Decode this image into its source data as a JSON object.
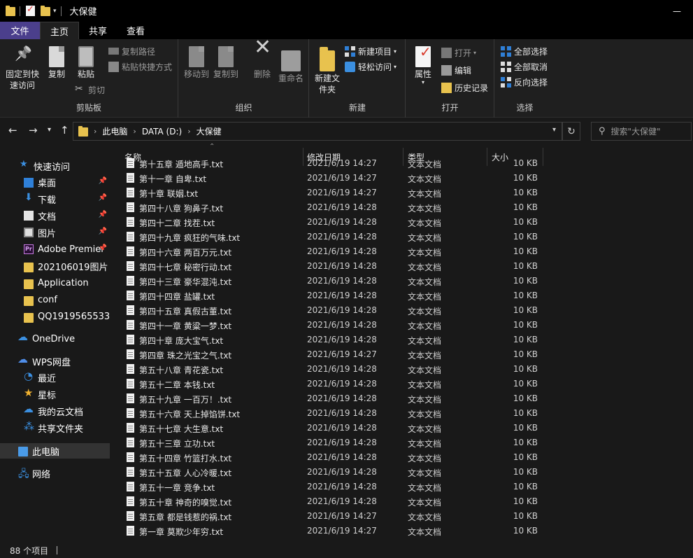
{
  "window": {
    "title": "大保健"
  },
  "ribbon_tabs": [
    "文件",
    "主页",
    "共享",
    "查看"
  ],
  "ribbon": {
    "clipboard": {
      "label": "剪贴板",
      "pin": "固定到快速访问",
      "copy": "复制",
      "paste": "粘贴",
      "copy_path": "复制路径",
      "paste_shortcut": "粘贴快捷方式",
      "cut": "剪切"
    },
    "organize": {
      "label": "组织",
      "move_to": "移动到",
      "copy_to": "复制到",
      "delete": "删除",
      "rename": "重命名"
    },
    "new": {
      "label": "新建",
      "new_folder": "新建文件夹",
      "new_item": "新建项目",
      "easy_access": "轻松访问"
    },
    "open": {
      "label": "打开",
      "properties": "属性",
      "open": "打开",
      "edit": "编辑",
      "history": "历史记录"
    },
    "select": {
      "label": "选择",
      "select_all": "全部选择",
      "select_none": "全部取消",
      "invert": "反向选择"
    }
  },
  "address": {
    "crumbs": [
      "此电脑",
      "DATA (D:)",
      "大保健"
    ],
    "search_placeholder": "搜索\"大保健\""
  },
  "sidebar": {
    "quick_access": "快速访问",
    "pinned": [
      "桌面",
      "下载",
      "文档",
      "图片",
      "Adobe Premier"
    ],
    "folders": [
      "202106019图片",
      "Application",
      "conf",
      "QQ1919565533"
    ],
    "onedrive": "OneDrive",
    "wps": "WPS网盘",
    "wps_items": [
      "最近",
      "星标",
      "我的云文档",
      "共享文件夹"
    ],
    "this_pc": "此电脑",
    "network": "网络"
  },
  "columns": {
    "name": "名称",
    "date": "修改日期",
    "type": "类型",
    "size": "大小"
  },
  "files": [
    {
      "name": "第十五章 遁地高手.txt",
      "date": "2021/6/19 14:27",
      "type": "文本文档",
      "size": "10 KB"
    },
    {
      "name": "第十一章 自卑.txt",
      "date": "2021/6/19 14:27",
      "type": "文本文档",
      "size": "10 KB"
    },
    {
      "name": "第十章 联姻.txt",
      "date": "2021/6/19 14:27",
      "type": "文本文档",
      "size": "10 KB"
    },
    {
      "name": "第四十八章 狗鼻子.txt",
      "date": "2021/6/19 14:28",
      "type": "文本文档",
      "size": "10 KB"
    },
    {
      "name": "第四十二章 找茬.txt",
      "date": "2021/6/19 14:28",
      "type": "文本文档",
      "size": "10 KB"
    },
    {
      "name": "第四十九章 疯狂的气味.txt",
      "date": "2021/6/19 14:28",
      "type": "文本文档",
      "size": "10 KB"
    },
    {
      "name": "第四十六章 两百万元.txt",
      "date": "2021/6/19 14:28",
      "type": "文本文档",
      "size": "10 KB"
    },
    {
      "name": "第四十七章 秘密行动.txt",
      "date": "2021/6/19 14:28",
      "type": "文本文档",
      "size": "10 KB"
    },
    {
      "name": "第四十三章 豪华混沌.txt",
      "date": "2021/6/19 14:28",
      "type": "文本文档",
      "size": "10 KB"
    },
    {
      "name": "第四十四章 盐罐.txt",
      "date": "2021/6/19 14:28",
      "type": "文本文档",
      "size": "10 KB"
    },
    {
      "name": "第四十五章 真假古董.txt",
      "date": "2021/6/19 14:28",
      "type": "文本文档",
      "size": "10 KB"
    },
    {
      "name": "第四十一章 黄粱一梦.txt",
      "date": "2021/6/19 14:28",
      "type": "文本文档",
      "size": "10 KB"
    },
    {
      "name": "第四十章 庞大宝气.txt",
      "date": "2021/6/19 14:28",
      "type": "文本文档",
      "size": "10 KB"
    },
    {
      "name": "第四章 珠之光宝之气.txt",
      "date": "2021/6/19 14:27",
      "type": "文本文档",
      "size": "10 KB"
    },
    {
      "name": "第五十八章 青花瓷.txt",
      "date": "2021/6/19 14:28",
      "type": "文本文档",
      "size": "10 KB"
    },
    {
      "name": "第五十二章 本钱.txt",
      "date": "2021/6/19 14:28",
      "type": "文本文档",
      "size": "10 KB"
    },
    {
      "name": "第五十九章 一百万！.txt",
      "date": "2021/6/19 14:28",
      "type": "文本文档",
      "size": "10 KB"
    },
    {
      "name": "第五十六章 天上掉馅饼.txt",
      "date": "2021/6/19 14:28",
      "type": "文本文档",
      "size": "10 KB"
    },
    {
      "name": "第五十七章 大生意.txt",
      "date": "2021/6/19 14:28",
      "type": "文本文档",
      "size": "10 KB"
    },
    {
      "name": "第五十三章 立功.txt",
      "date": "2021/6/19 14:28",
      "type": "文本文档",
      "size": "10 KB"
    },
    {
      "name": "第五十四章 竹篮打水.txt",
      "date": "2021/6/19 14:28",
      "type": "文本文档",
      "size": "10 KB"
    },
    {
      "name": "第五十五章 人心冷暖.txt",
      "date": "2021/6/19 14:28",
      "type": "文本文档",
      "size": "10 KB"
    },
    {
      "name": "第五十一章 竞争.txt",
      "date": "2021/6/19 14:28",
      "type": "文本文档",
      "size": "10 KB"
    },
    {
      "name": "第五十章 神奇的嗅觉.txt",
      "date": "2021/6/19 14:28",
      "type": "文本文档",
      "size": "10 KB"
    },
    {
      "name": "第五章 都是钱惹的祸.txt",
      "date": "2021/6/19 14:27",
      "type": "文本文档",
      "size": "10 KB"
    },
    {
      "name": "第一章 莫欺少年穷.txt",
      "date": "2021/6/19 14:27",
      "type": "文本文档",
      "size": "10 KB"
    }
  ],
  "status": {
    "count": "88 个项目"
  },
  "colors": {
    "file_tab": "#4b3f8c",
    "folder": "#e8c24e",
    "accent_blue": "#2f7fd6"
  },
  "icons": [
    "folder-icon",
    "pin-icon",
    "copy-icon",
    "paste-icon",
    "scissors-icon",
    "delete-icon",
    "rename-icon",
    "properties-icon",
    "text-file-icon",
    "search-icon",
    "refresh-icon",
    "star-icon",
    "cloud-icon",
    "computer-icon",
    "network-icon"
  ]
}
